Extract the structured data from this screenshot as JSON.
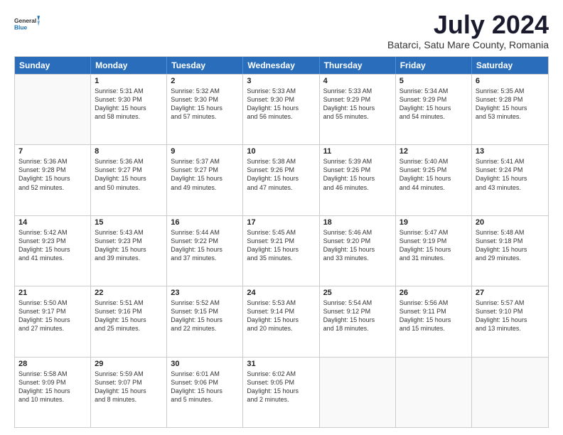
{
  "header": {
    "logo_general": "General",
    "logo_blue": "Blue",
    "main_title": "July 2024",
    "subtitle": "Batarci, Satu Mare County, Romania"
  },
  "calendar": {
    "days": [
      "Sunday",
      "Monday",
      "Tuesday",
      "Wednesday",
      "Thursday",
      "Friday",
      "Saturday"
    ],
    "rows": [
      [
        {
          "day": "",
          "empty": true
        },
        {
          "day": "1",
          "sunrise": "Sunrise: 5:31 AM",
          "sunset": "Sunset: 9:30 PM",
          "daylight": "Daylight: 15 hours",
          "extra": "and 58 minutes."
        },
        {
          "day": "2",
          "sunrise": "Sunrise: 5:32 AM",
          "sunset": "Sunset: 9:30 PM",
          "daylight": "Daylight: 15 hours",
          "extra": "and 57 minutes."
        },
        {
          "day": "3",
          "sunrise": "Sunrise: 5:33 AM",
          "sunset": "Sunset: 9:30 PM",
          "daylight": "Daylight: 15 hours",
          "extra": "and 56 minutes."
        },
        {
          "day": "4",
          "sunrise": "Sunrise: 5:33 AM",
          "sunset": "Sunset: 9:29 PM",
          "daylight": "Daylight: 15 hours",
          "extra": "and 55 minutes."
        },
        {
          "day": "5",
          "sunrise": "Sunrise: 5:34 AM",
          "sunset": "Sunset: 9:29 PM",
          "daylight": "Daylight: 15 hours",
          "extra": "and 54 minutes."
        },
        {
          "day": "6",
          "sunrise": "Sunrise: 5:35 AM",
          "sunset": "Sunset: 9:28 PM",
          "daylight": "Daylight: 15 hours",
          "extra": "and 53 minutes."
        }
      ],
      [
        {
          "day": "7",
          "sunrise": "Sunrise: 5:36 AM",
          "sunset": "Sunset: 9:28 PM",
          "daylight": "Daylight: 15 hours",
          "extra": "and 52 minutes."
        },
        {
          "day": "8",
          "sunrise": "Sunrise: 5:36 AM",
          "sunset": "Sunset: 9:27 PM",
          "daylight": "Daylight: 15 hours",
          "extra": "and 50 minutes."
        },
        {
          "day": "9",
          "sunrise": "Sunrise: 5:37 AM",
          "sunset": "Sunset: 9:27 PM",
          "daylight": "Daylight: 15 hours",
          "extra": "and 49 minutes."
        },
        {
          "day": "10",
          "sunrise": "Sunrise: 5:38 AM",
          "sunset": "Sunset: 9:26 PM",
          "daylight": "Daylight: 15 hours",
          "extra": "and 47 minutes."
        },
        {
          "day": "11",
          "sunrise": "Sunrise: 5:39 AM",
          "sunset": "Sunset: 9:26 PM",
          "daylight": "Daylight: 15 hours",
          "extra": "and 46 minutes."
        },
        {
          "day": "12",
          "sunrise": "Sunrise: 5:40 AM",
          "sunset": "Sunset: 9:25 PM",
          "daylight": "Daylight: 15 hours",
          "extra": "and 44 minutes."
        },
        {
          "day": "13",
          "sunrise": "Sunrise: 5:41 AM",
          "sunset": "Sunset: 9:24 PM",
          "daylight": "Daylight: 15 hours",
          "extra": "and 43 minutes."
        }
      ],
      [
        {
          "day": "14",
          "sunrise": "Sunrise: 5:42 AM",
          "sunset": "Sunset: 9:23 PM",
          "daylight": "Daylight: 15 hours",
          "extra": "and 41 minutes."
        },
        {
          "day": "15",
          "sunrise": "Sunrise: 5:43 AM",
          "sunset": "Sunset: 9:23 PM",
          "daylight": "Daylight: 15 hours",
          "extra": "and 39 minutes."
        },
        {
          "day": "16",
          "sunrise": "Sunrise: 5:44 AM",
          "sunset": "Sunset: 9:22 PM",
          "daylight": "Daylight: 15 hours",
          "extra": "and 37 minutes."
        },
        {
          "day": "17",
          "sunrise": "Sunrise: 5:45 AM",
          "sunset": "Sunset: 9:21 PM",
          "daylight": "Daylight: 15 hours",
          "extra": "and 35 minutes."
        },
        {
          "day": "18",
          "sunrise": "Sunrise: 5:46 AM",
          "sunset": "Sunset: 9:20 PM",
          "daylight": "Daylight: 15 hours",
          "extra": "and 33 minutes."
        },
        {
          "day": "19",
          "sunrise": "Sunrise: 5:47 AM",
          "sunset": "Sunset: 9:19 PM",
          "daylight": "Daylight: 15 hours",
          "extra": "and 31 minutes."
        },
        {
          "day": "20",
          "sunrise": "Sunrise: 5:48 AM",
          "sunset": "Sunset: 9:18 PM",
          "daylight": "Daylight: 15 hours",
          "extra": "and 29 minutes."
        }
      ],
      [
        {
          "day": "21",
          "sunrise": "Sunrise: 5:50 AM",
          "sunset": "Sunset: 9:17 PM",
          "daylight": "Daylight: 15 hours",
          "extra": "and 27 minutes."
        },
        {
          "day": "22",
          "sunrise": "Sunrise: 5:51 AM",
          "sunset": "Sunset: 9:16 PM",
          "daylight": "Daylight: 15 hours",
          "extra": "and 25 minutes."
        },
        {
          "day": "23",
          "sunrise": "Sunrise: 5:52 AM",
          "sunset": "Sunset: 9:15 PM",
          "daylight": "Daylight: 15 hours",
          "extra": "and 22 minutes."
        },
        {
          "day": "24",
          "sunrise": "Sunrise: 5:53 AM",
          "sunset": "Sunset: 9:14 PM",
          "daylight": "Daylight: 15 hours",
          "extra": "and 20 minutes."
        },
        {
          "day": "25",
          "sunrise": "Sunrise: 5:54 AM",
          "sunset": "Sunset: 9:12 PM",
          "daylight": "Daylight: 15 hours",
          "extra": "and 18 minutes."
        },
        {
          "day": "26",
          "sunrise": "Sunrise: 5:56 AM",
          "sunset": "Sunset: 9:11 PM",
          "daylight": "Daylight: 15 hours",
          "extra": "and 15 minutes."
        },
        {
          "day": "27",
          "sunrise": "Sunrise: 5:57 AM",
          "sunset": "Sunset: 9:10 PM",
          "daylight": "Daylight: 15 hours",
          "extra": "and 13 minutes."
        }
      ],
      [
        {
          "day": "28",
          "sunrise": "Sunrise: 5:58 AM",
          "sunset": "Sunset: 9:09 PM",
          "daylight": "Daylight: 15 hours",
          "extra": "and 10 minutes."
        },
        {
          "day": "29",
          "sunrise": "Sunrise: 5:59 AM",
          "sunset": "Sunset: 9:07 PM",
          "daylight": "Daylight: 15 hours",
          "extra": "and 8 minutes."
        },
        {
          "day": "30",
          "sunrise": "Sunrise: 6:01 AM",
          "sunset": "Sunset: 9:06 PM",
          "daylight": "Daylight: 15 hours",
          "extra": "and 5 minutes."
        },
        {
          "day": "31",
          "sunrise": "Sunrise: 6:02 AM",
          "sunset": "Sunset: 9:05 PM",
          "daylight": "Daylight: 15 hours",
          "extra": "and 2 minutes."
        },
        {
          "day": "",
          "empty": true
        },
        {
          "day": "",
          "empty": true
        },
        {
          "day": "",
          "empty": true
        }
      ]
    ]
  }
}
